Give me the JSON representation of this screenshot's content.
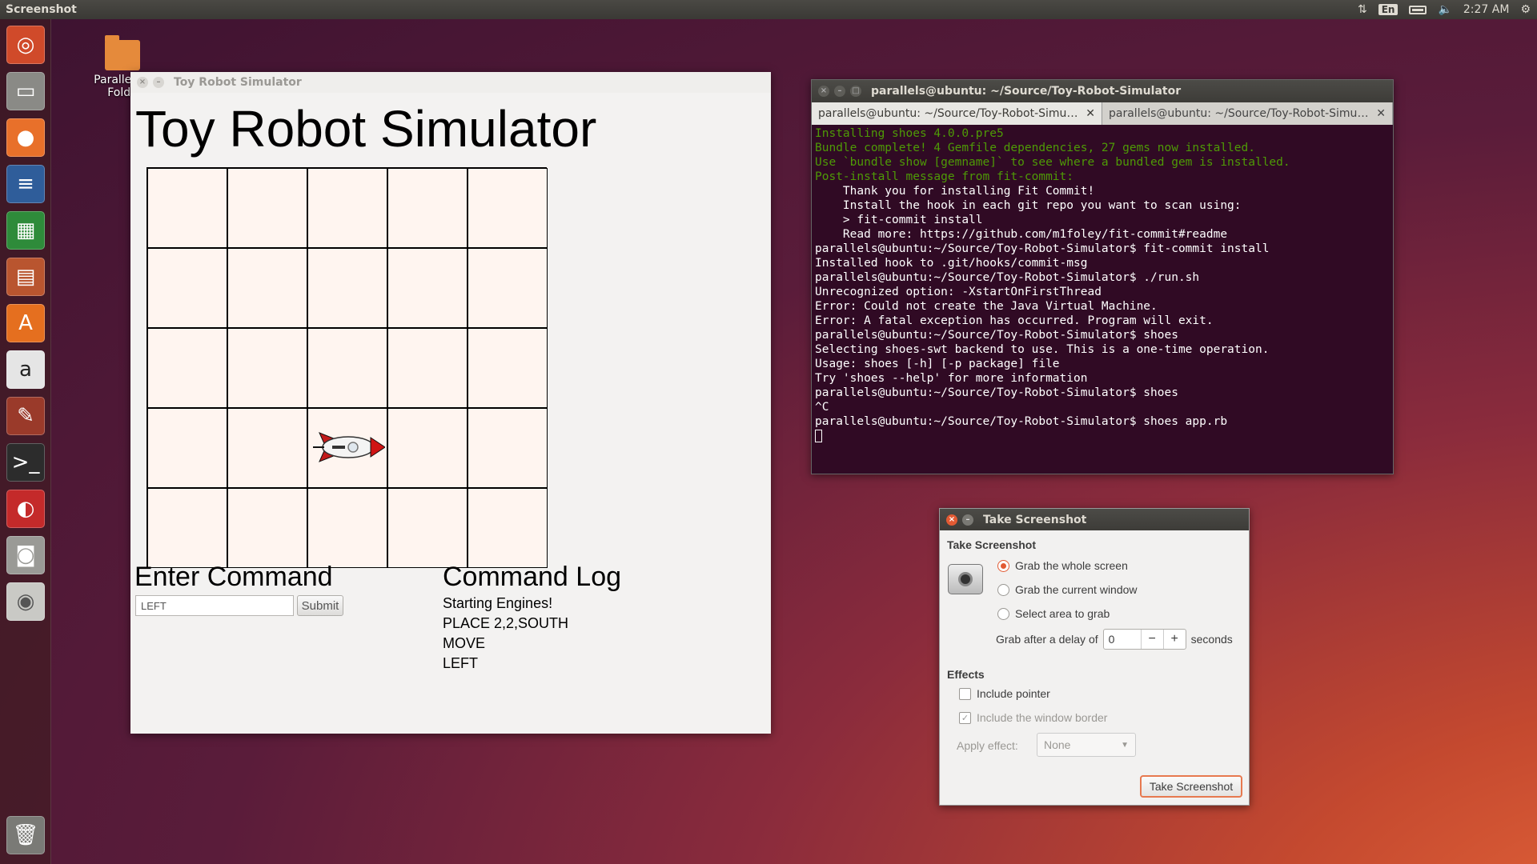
{
  "top_panel": {
    "app_title": "Screenshot",
    "keyboard_layout": "En",
    "clock": "2:27 AM"
  },
  "launcher": {
    "items": [
      "ubuntu-dash-icon",
      "files-icon",
      "firefox-icon",
      "writer-icon",
      "calc-icon",
      "impress-icon",
      "software-center-icon",
      "amazon-icon",
      "system-settings-icon",
      "terminal-icon",
      "parallels-icon",
      "screenshot-icon",
      "dvd-icon",
      "trash-icon"
    ]
  },
  "desktop": {
    "folder_label_line1": "Parallels S",
    "folder_label_line2": "Folde"
  },
  "toy_window": {
    "title": "Toy Robot Simulator",
    "heading": "Toy Robot Simulator",
    "enter_command_heading": "Enter Command",
    "command_input_value": "LEFT",
    "submit_label": "Submit",
    "command_log_heading": "Command Log",
    "log": [
      "Starting Engines!",
      "PLACE 2,2,SOUTH",
      "MOVE",
      "LEFT"
    ],
    "grid": {
      "rows": 5,
      "cols": 5,
      "robot_cell": {
        "row": 3,
        "col": 2
      },
      "cell_color": "#fff5f0"
    }
  },
  "terminal": {
    "title": "parallels@ubuntu: ~/Source/Toy-Robot-Simulator",
    "tabs": [
      "parallels@ubuntu: ~/Source/Toy-Robot-Simula...",
      "parallels@ubuntu: ~/Source/Toy-Robot-Simula..."
    ],
    "lines": [
      {
        "text": "Installing shoes 4.0.0.pre5",
        "green": true
      },
      {
        "text": "Bundle complete! 4 Gemfile dependencies, 27 gems now installed.",
        "green": true
      },
      {
        "text": "Use `bundle show [gemname]` to see where a bundled gem is installed.",
        "green": true
      },
      {
        "text": "Post-install message from fit-commit:",
        "green": true
      },
      {
        "text": "    Thank you for installing Fit Commit!",
        "green": false
      },
      {
        "text": "    Install the hook in each git repo you want to scan using:",
        "green": false
      },
      {
        "text": "",
        "green": false
      },
      {
        "text": "    > fit-commit install",
        "green": false
      },
      {
        "text": "",
        "green": false
      },
      {
        "text": "    Read more: https://github.com/m1foley/fit-commit#readme",
        "green": false
      },
      {
        "text": "parallels@ubuntu:~/Source/Toy-Robot-Simulator$ fit-commit install",
        "green": false
      },
      {
        "text": "Installed hook to .git/hooks/commit-msg",
        "green": false
      },
      {
        "text": "parallels@ubuntu:~/Source/Toy-Robot-Simulator$ ./run.sh",
        "green": false
      },
      {
        "text": "Unrecognized option: -XstartOnFirstThread",
        "green": false
      },
      {
        "text": "Error: Could not create the Java Virtual Machine.",
        "green": false
      },
      {
        "text": "Error: A fatal exception has occurred. Program will exit.",
        "green": false
      },
      {
        "text": "parallels@ubuntu:~/Source/Toy-Robot-Simulator$ shoes",
        "green": false
      },
      {
        "text": "Selecting shoes-swt backend to use. This is a one-time operation.",
        "green": false
      },
      {
        "text": "Usage: shoes [-h] [-p package] file",
        "green": false
      },
      {
        "text": "Try 'shoes --help' for more information",
        "green": false
      },
      {
        "text": "parallels@ubuntu:~/Source/Toy-Robot-Simulator$ shoes",
        "green": false
      },
      {
        "text": "^C",
        "green": false
      },
      {
        "text": "parallels@ubuntu:~/Source/Toy-Robot-Simulator$ shoes app.rb",
        "green": false
      }
    ],
    "colors": {
      "background": "#300a24",
      "green": "#4e9a06",
      "text": "#ffffff"
    }
  },
  "screenshot_dialog": {
    "title": "Take Screenshot",
    "section_take": "Take Screenshot",
    "options": [
      {
        "label": "Grab the whole screen",
        "selected": true
      },
      {
        "label": "Grab the current window",
        "selected": false
      },
      {
        "label": "Select area to grab",
        "selected": false
      }
    ],
    "delay_label": "Grab after a delay of",
    "delay_value": "0",
    "delay_unit": "seconds",
    "section_effects": "Effects",
    "include_pointer": {
      "label": "Include pointer",
      "checked": false
    },
    "include_border": {
      "label": "Include the window border",
      "checked": true,
      "disabled": true
    },
    "apply_effect_label": "Apply effect:",
    "apply_effect_value": "None",
    "take_button": "Take Screenshot",
    "accent_color": "#e25a33"
  }
}
